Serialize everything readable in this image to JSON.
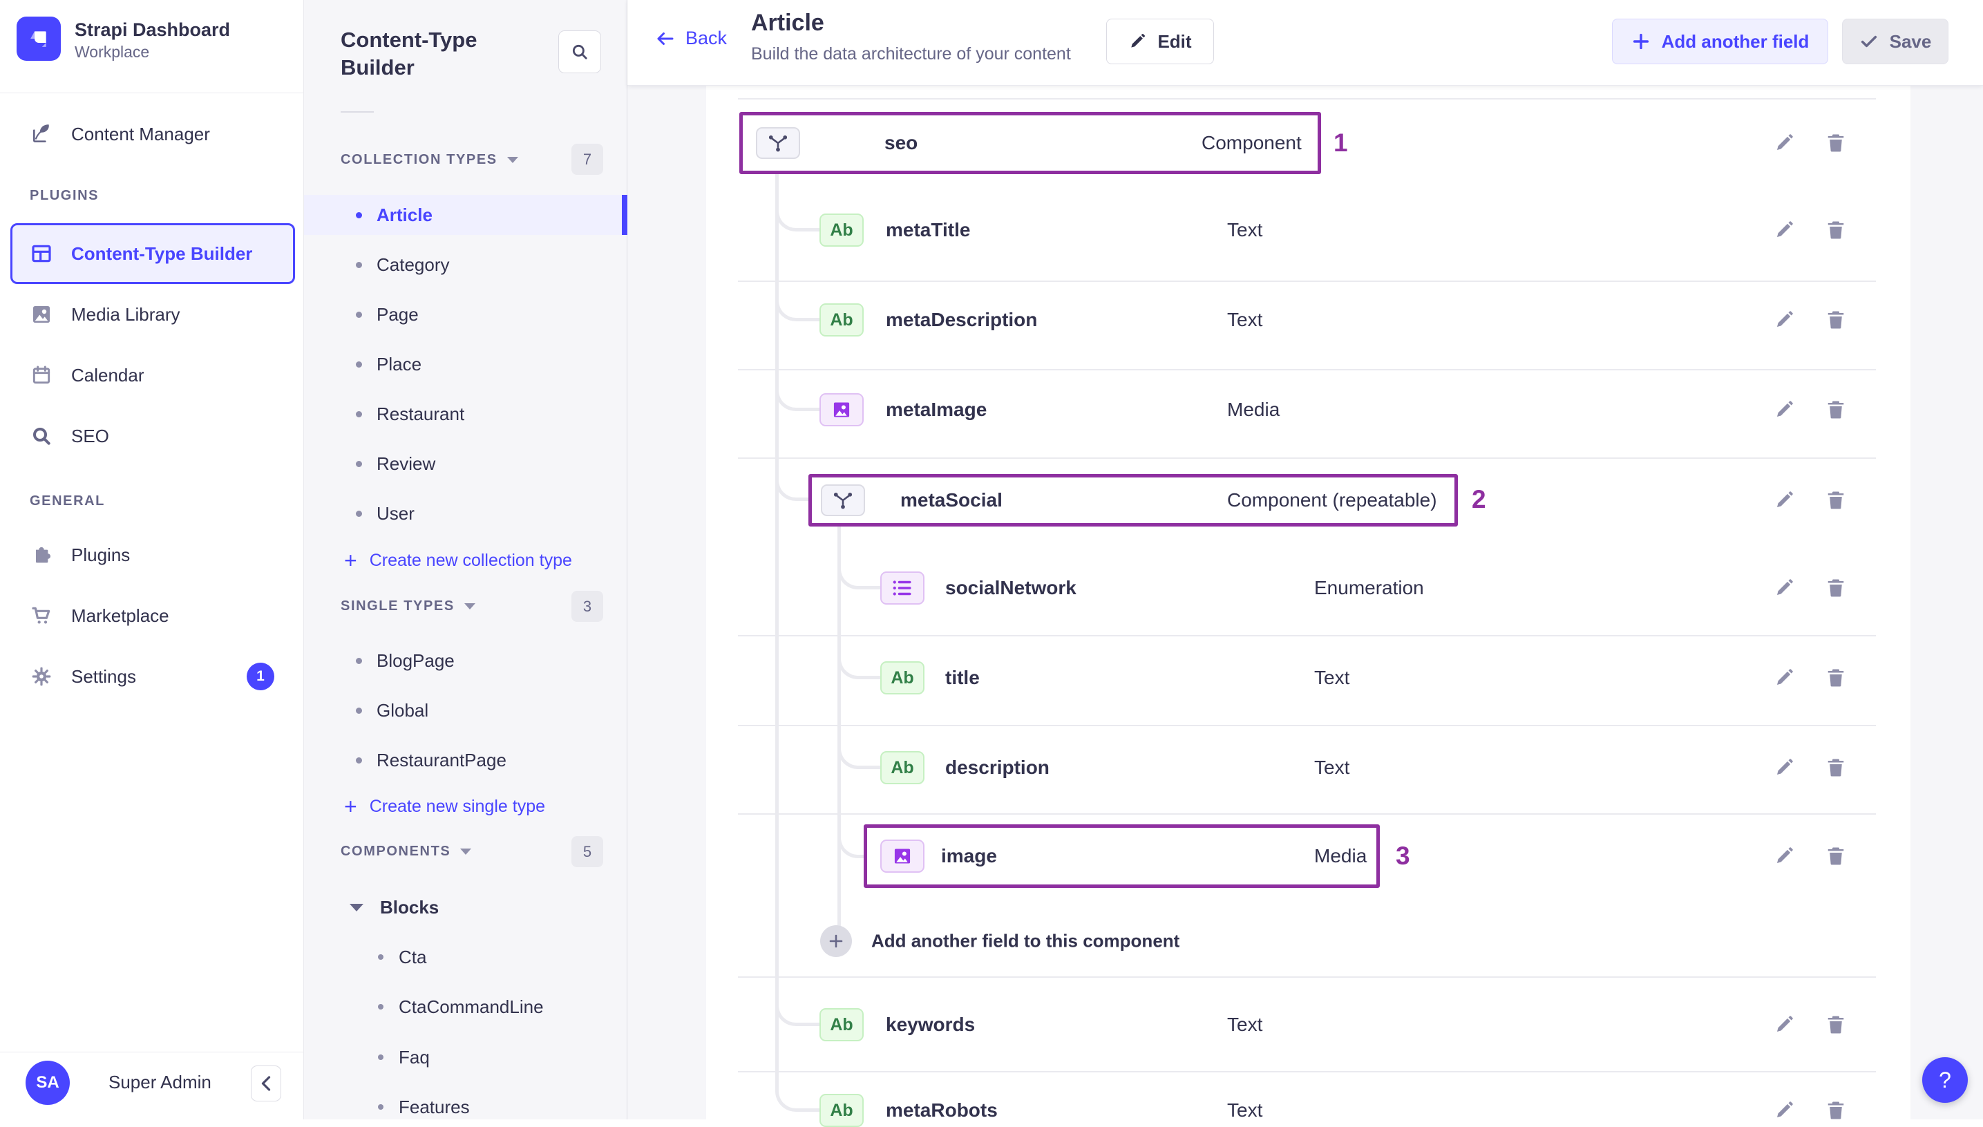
{
  "brand": {
    "name": "Strapi Dashboard",
    "workspace": "Workplace"
  },
  "sidebar": {
    "content_manager": "Content Manager",
    "plugins_section": "PLUGINS",
    "plugins_items": [
      "Content-Type Builder",
      "Media Library",
      "Calendar",
      "SEO"
    ],
    "general_section": "GENERAL",
    "general_items": [
      "Plugins",
      "Marketplace",
      "Settings"
    ],
    "settings_badge": "1",
    "user_initials": "SA",
    "user_name": "Super Admin"
  },
  "subnav": {
    "title": "Content-Type Builder",
    "collection": {
      "label": "COLLECTION TYPES",
      "count": "7",
      "items": [
        "Article",
        "Category",
        "Page",
        "Place",
        "Restaurant",
        "Review",
        "User"
      ],
      "create": "Create new collection type"
    },
    "single": {
      "label": "SINGLE TYPES",
      "count": "3",
      "items": [
        "BlogPage",
        "Global",
        "RestaurantPage"
      ],
      "create": "Create new single type"
    },
    "components": {
      "label": "COMPONENTS",
      "count": "5",
      "category": "Blocks",
      "items": [
        "Cta",
        "CtaCommandLine",
        "Faq",
        "Features"
      ]
    }
  },
  "header": {
    "back": "Back",
    "title": "Article",
    "subtitle": "Build the data architecture of your content",
    "edit": "Edit",
    "add_field": "Add another field",
    "save": "Save"
  },
  "fields": [
    {
      "name": "seo",
      "type": "Component",
      "icon": "component-icon",
      "annotation": "1"
    },
    {
      "name": "metaTitle",
      "type": "Text",
      "icon": "text-icon"
    },
    {
      "name": "metaDescription",
      "type": "Text",
      "icon": "text-icon"
    },
    {
      "name": "metaImage",
      "type": "Media",
      "icon": "media-icon"
    },
    {
      "name": "metaSocial",
      "type": "Component (repeatable)",
      "icon": "component-icon",
      "annotation": "2"
    },
    {
      "name": "socialNetwork",
      "type": "Enumeration",
      "icon": "enumeration-icon"
    },
    {
      "name": "title",
      "type": "Text",
      "icon": "text-icon"
    },
    {
      "name": "description",
      "type": "Text",
      "icon": "text-icon"
    },
    {
      "name": "image",
      "type": "Media",
      "icon": "media-icon",
      "annotation": "3"
    },
    {
      "name": "keywords",
      "type": "Text",
      "icon": "text-icon"
    },
    {
      "name": "metaRobots",
      "type": "Text",
      "icon": "text-icon"
    }
  ],
  "text_icon_glyph": "Ab",
  "add_component_field": "Add another field to this component",
  "help_glyph": "?",
  "colors": {
    "primary": "#4945ff",
    "primary_bg": "#f0f0ff",
    "annotation": "#8e2fa0",
    "text_dark": "#32324d",
    "text_gray": "#666687",
    "border": "#eaeaef",
    "page_bg": "#f6f6f9",
    "green_field": "#328048",
    "purple_field": "#9736e8"
  }
}
